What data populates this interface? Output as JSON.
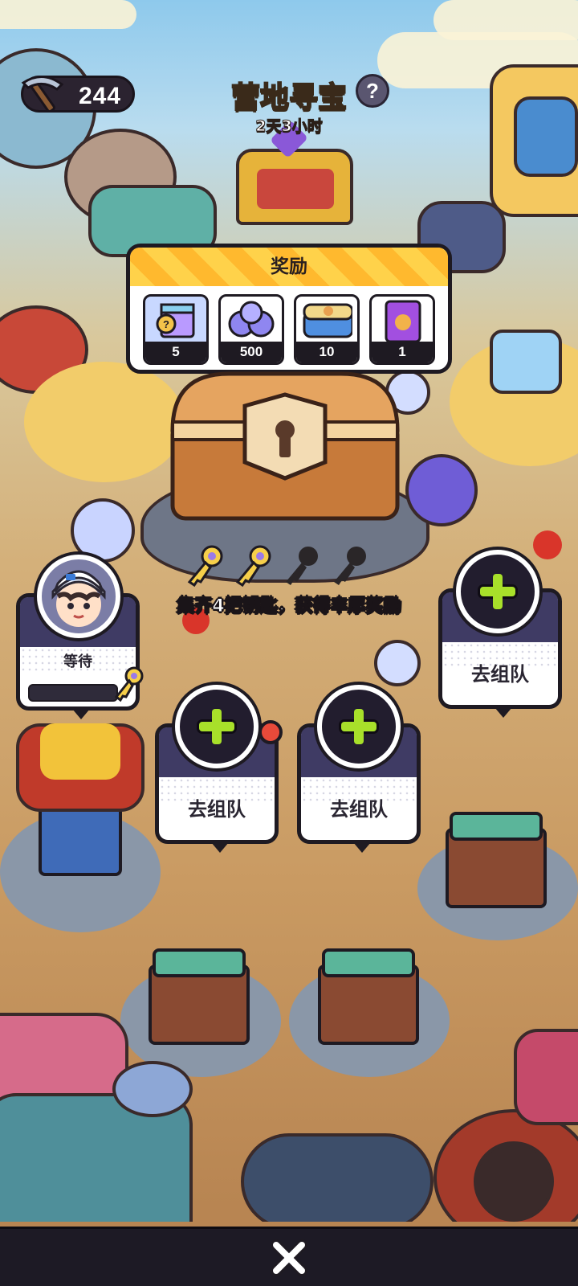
{
  "hud": {
    "pickaxe_count": "244",
    "pickaxe_icon": "pickaxe-icon",
    "title": "营地寻宝",
    "help_label": "?",
    "timer": "2天3小时"
  },
  "rewards": {
    "header": "奖励",
    "items": [
      {
        "icon": "mystery-box-icon",
        "count": "5"
      },
      {
        "icon": "orbs-icon",
        "count": "500"
      },
      {
        "icon": "lunchbox-chest-icon",
        "count": "10"
      },
      {
        "icon": "card-pack-icon",
        "count": "1"
      }
    ]
  },
  "keys": {
    "collected": 2,
    "total": 4
  },
  "hint": "集齐4把钥匙，获得丰厚奖励",
  "team": {
    "player_slot": {
      "status": "等待"
    },
    "invite_label": "去组队"
  },
  "colors": {
    "title_yellow": "#fff36a",
    "plus_green": "#a8e02a",
    "slot_header": "#3f3b64",
    "notify_red": "#e84a3a"
  },
  "bottom": {
    "close_icon": "close-icon"
  }
}
